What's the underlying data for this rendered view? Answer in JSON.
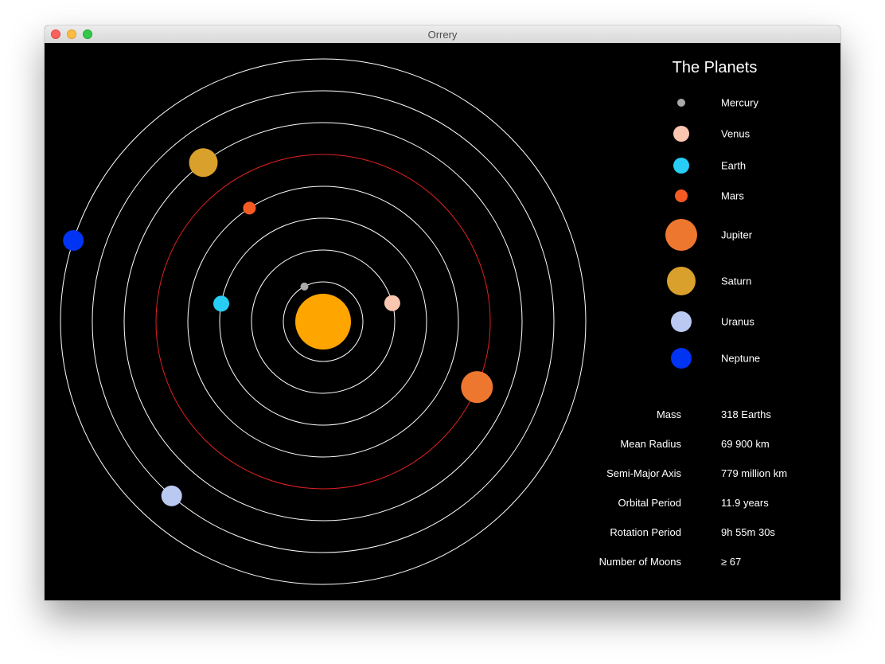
{
  "window": {
    "title": "Orrery"
  },
  "sidebar": {
    "title": "The Planets"
  },
  "sun": {
    "name": "Sun",
    "color": "#ffa500"
  },
  "selected_planet": "Jupiter",
  "planets": [
    {
      "name": "Mercury",
      "color": "#aaaaaa",
      "orbit_color": "#ffffff",
      "angle_deg": 242
    },
    {
      "name": "Venus",
      "color": "#fbc6b0",
      "orbit_color": "#ffffff",
      "angle_deg": 345
    },
    {
      "name": "Earth",
      "color": "#27cdf5",
      "orbit_color": "#ffffff",
      "angle_deg": 190
    },
    {
      "name": "Mars",
      "color": "#f55a22",
      "orbit_color": "#ffffff",
      "angle_deg": 237
    },
    {
      "name": "Jupiter",
      "color": "#ee7730",
      "orbit_color": "#e02020",
      "angle_deg": 23
    },
    {
      "name": "Saturn",
      "color": "#d9a02c",
      "orbit_color": "#ffffff",
      "angle_deg": 233
    },
    {
      "name": "Uranus",
      "color": "#bac9f2",
      "orbit_color": "#ffffff",
      "angle_deg": 131
    },
    {
      "name": "Neptune",
      "color": "#0033f2",
      "orbit_color": "#ffffff",
      "angle_deg": 198
    }
  ],
  "facts": [
    {
      "label": "Mass",
      "value": "318 Earths"
    },
    {
      "label": "Mean Radius",
      "value": "69 900 km"
    },
    {
      "label": "Semi-Major Axis",
      "value": "779 million km"
    },
    {
      "label": "Orbital Period",
      "value": "11.9 years"
    },
    {
      "label": "Rotation Period",
      "value": "9h 55m 30s"
    },
    {
      "label": "Number of Moons",
      "value": "≥ 67"
    }
  ]
}
